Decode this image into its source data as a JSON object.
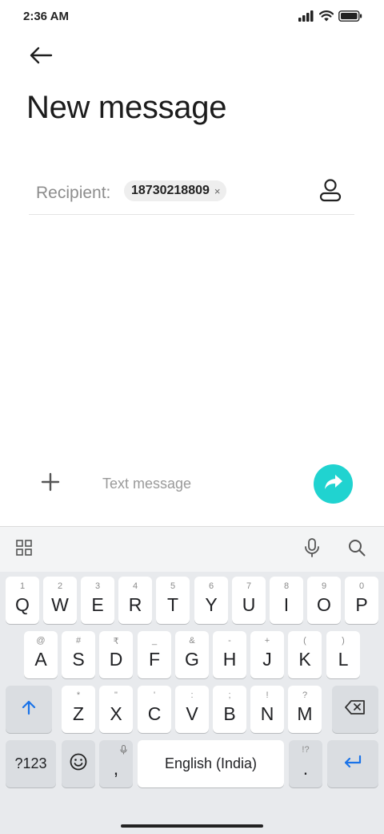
{
  "status_bar": {
    "time": "2:36 AM",
    "icons": [
      "signal-icon",
      "wifi-icon",
      "battery-icon"
    ]
  },
  "header": {
    "back_icon": "arrow-left-icon",
    "title": "New message"
  },
  "recipient": {
    "label": "Recipient:",
    "chip_value": "18730218809",
    "chip_remove": "×",
    "contact_icon": "person-icon"
  },
  "compose": {
    "attach_icon": "plus-icon",
    "placeholder": "Text message",
    "send_icon": "send-arrow-icon",
    "send_color": "#20d3d0"
  },
  "keyboard": {
    "toolbar": {
      "left_icon": "apps-grid-icon",
      "right_icons": [
        "microphone-icon",
        "search-icon"
      ]
    },
    "row1": [
      {
        "label": "Q",
        "hint": "1"
      },
      {
        "label": "W",
        "hint": "2"
      },
      {
        "label": "E",
        "hint": "3"
      },
      {
        "label": "R",
        "hint": "4"
      },
      {
        "label": "T",
        "hint": "5"
      },
      {
        "label": "Y",
        "hint": "6"
      },
      {
        "label": "U",
        "hint": "7"
      },
      {
        "label": "I",
        "hint": "8"
      },
      {
        "label": "O",
        "hint": "9"
      },
      {
        "label": "P",
        "hint": "0"
      }
    ],
    "row2": [
      {
        "label": "A",
        "hint": "@"
      },
      {
        "label": "S",
        "hint": "#"
      },
      {
        "label": "D",
        "hint": "₹"
      },
      {
        "label": "F",
        "hint": "_"
      },
      {
        "label": "G",
        "hint": "&"
      },
      {
        "label": "H",
        "hint": "-"
      },
      {
        "label": "J",
        "hint": "+"
      },
      {
        "label": "K",
        "hint": "("
      },
      {
        "label": "L",
        "hint": ")"
      }
    ],
    "row3": [
      {
        "label": "Z",
        "hint": "*"
      },
      {
        "label": "X",
        "hint": "\""
      },
      {
        "label": "C",
        "hint": "'"
      },
      {
        "label": "V",
        "hint": ":"
      },
      {
        "label": "B",
        "hint": ";"
      },
      {
        "label": "N",
        "hint": "!"
      },
      {
        "label": "M",
        "hint": "?"
      }
    ],
    "shift_icon": "shift-arrow-up-icon",
    "backspace_icon": "backspace-icon",
    "bottom": {
      "symbols": "?123",
      "emoji_icon": "emoji-icon",
      "comma": ",",
      "comma_hint_icon": "microphone-icon",
      "space": "English (India)",
      "period": ".",
      "period_hint": "!?",
      "enter_icon": "enter-arrow-icon"
    },
    "accent_color": "#1a73e8"
  }
}
